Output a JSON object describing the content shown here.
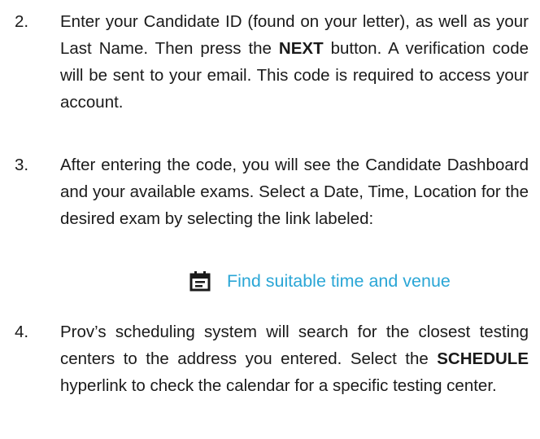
{
  "steps": [
    {
      "number": "2.",
      "parts": [
        "Enter your Candidate ID (found on your letter), as well as your Last Name.  Then press the ",
        "NEXT",
        " button. A verification code will be sent to your email. This code is required to access your account."
      ]
    },
    {
      "number": "3.",
      "text": "After entering the code, you will see the Candidate Dashboard and your available exams. Select a Date, Time, Location for the desired exam by selecting the link labeled:"
    },
    {
      "number": "4.",
      "parts": [
        "Prov’s scheduling system will search for the closest testing centers to the address you entered.  Select the ",
        "SCHEDULE",
        " hyperlink to check the calendar for a specific testing center."
      ]
    }
  ],
  "link": {
    "icon": "calendar-icon",
    "label": "Find suitable time and venue",
    "color": "#2aa6d6"
  }
}
